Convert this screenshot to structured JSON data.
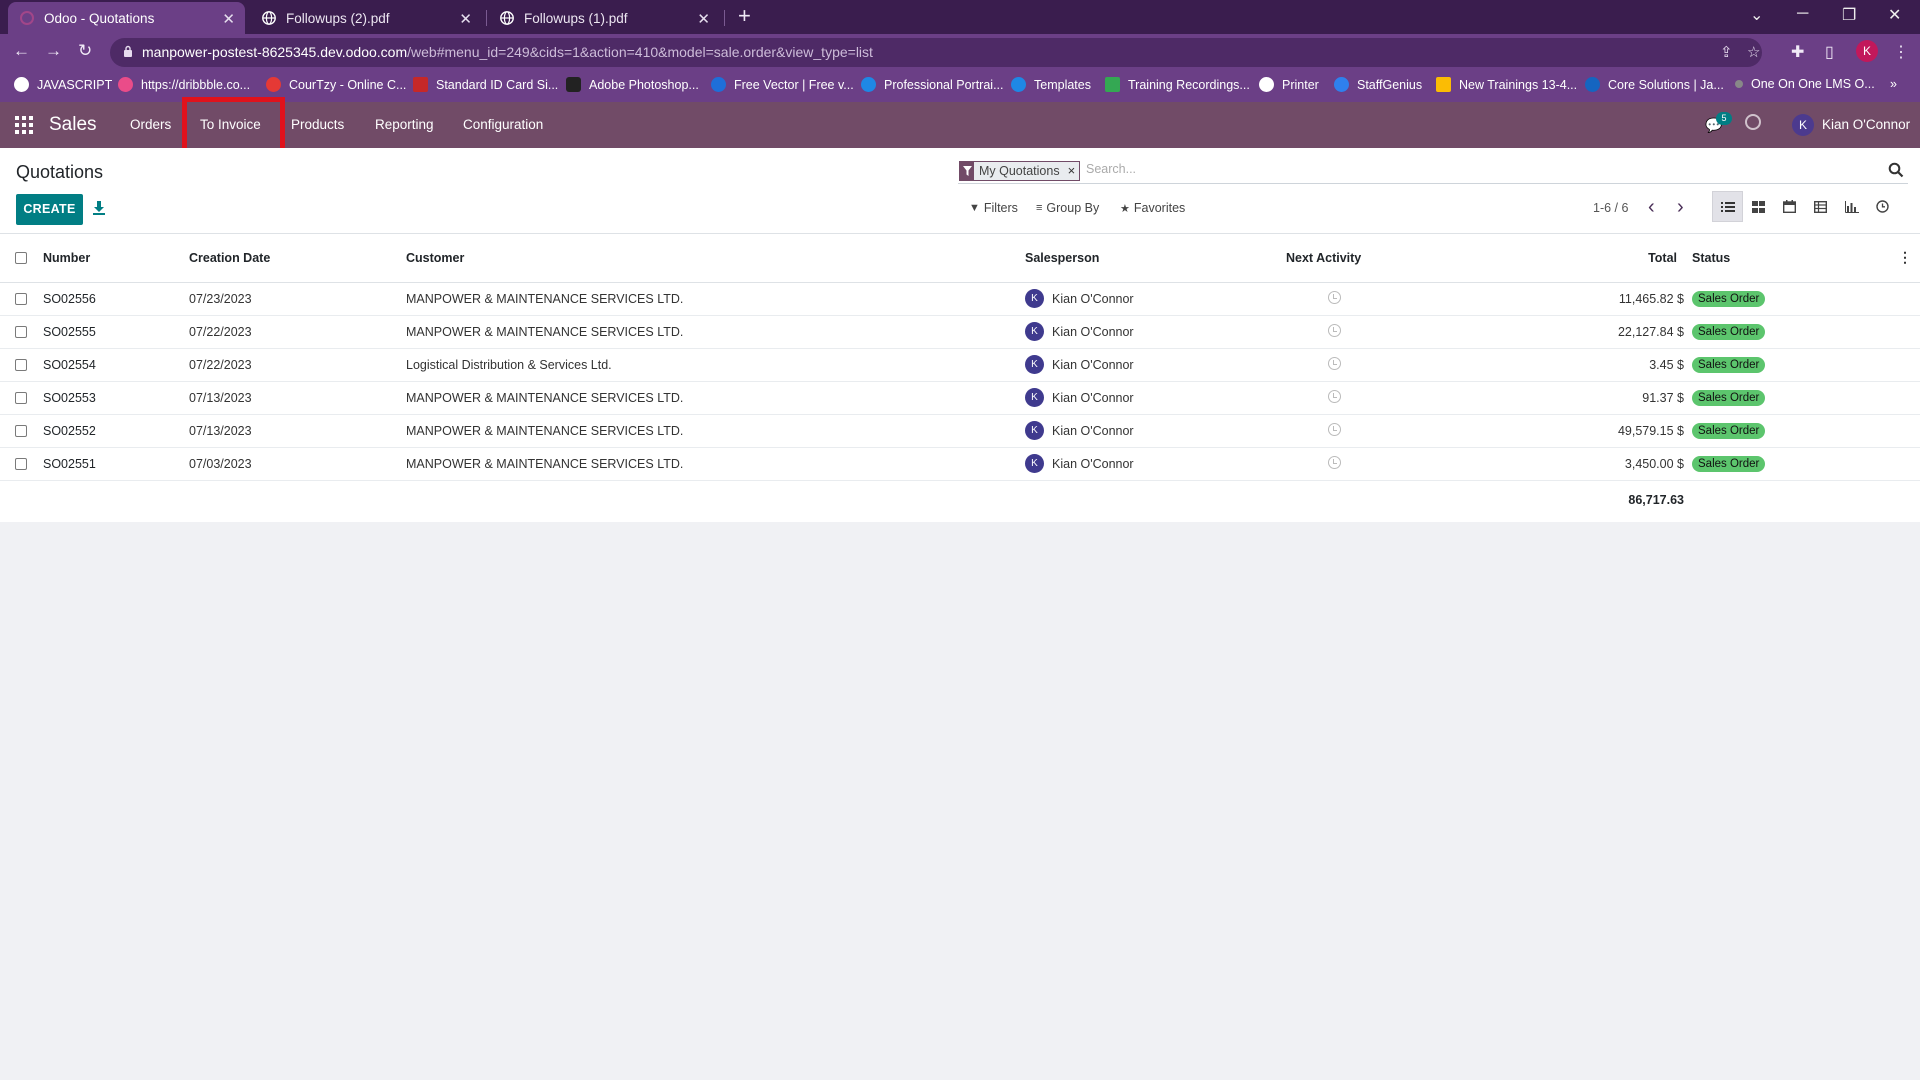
{
  "browser": {
    "tabs": [
      {
        "title": "Odoo - Quotations",
        "favicon": "odoo-icon",
        "active": true
      },
      {
        "title": "Followups (2).pdf",
        "favicon": "globe-icon",
        "active": false
      },
      {
        "title": "Followups (1).pdf",
        "favicon": "globe-icon",
        "active": false
      }
    ],
    "url_host": "manpower-postest-8625345.dev.odoo.com",
    "url_rest": "/web#menu_id=249&cids=1&action=410&model=sale.order&view_type=list",
    "profile_initial": "K",
    "bookmarks": [
      {
        "label": "JAVASCRIPT",
        "color": "#ffffff"
      },
      {
        "label": "https://dribbble.co...",
        "color": "#ea4c89"
      },
      {
        "label": "CourTzy - Online C...",
        "color": "#e53935"
      },
      {
        "label": "Standard ID Card Si...",
        "color": "#c62828"
      },
      {
        "label": "Adobe Photoshop...",
        "color": "#222222"
      },
      {
        "label": "Free Vector | Free v...",
        "color": "#1e6fd9"
      },
      {
        "label": "Professional Portrai...",
        "color": "#1e88e5"
      },
      {
        "label": "Templates",
        "color": "#1e88e5"
      },
      {
        "label": "Training Recordings...",
        "color": "#34a853"
      },
      {
        "label": "Printer",
        "color": "#ffffff"
      },
      {
        "label": "StaffGenius",
        "color": "#2f80ed"
      },
      {
        "label": "New Trainings 13-4...",
        "color": "#fbbc04"
      },
      {
        "label": "Core Solutions | Ja...",
        "color": "#1565c0"
      },
      {
        "label": "One On One LMS O...",
        "color": "#888888"
      }
    ],
    "more_bookmarks": "»"
  },
  "app": {
    "name": "Sales",
    "menu": [
      "Orders",
      "To Invoice",
      "Products",
      "Reporting",
      "Configuration"
    ],
    "highlighted_menu": "To Invoice",
    "message_count": "5",
    "user_initial": "K",
    "user_name": "Kian O'Connor"
  },
  "control_panel": {
    "title": "Quotations",
    "create_label": "CREATE",
    "facet_label": "My Quotations",
    "facet_remove": "×",
    "search_placeholder": "Search...",
    "filters_label": "Filters",
    "groupby_label": "Group By",
    "favorites_label": "Favorites",
    "pager": "1-6 / 6"
  },
  "list": {
    "columns": [
      "Number",
      "Creation Date",
      "Customer",
      "Salesperson",
      "Next Activity",
      "Total",
      "Status"
    ],
    "rows": [
      {
        "number": "SO02556",
        "date": "07/23/2023",
        "customer": "MANPOWER & MAINTENANCE SERVICES LTD.",
        "salesperson": "Kian O'Connor",
        "initial": "K",
        "total": "11,465.82 $",
        "status": "Sales Order"
      },
      {
        "number": "SO02555",
        "date": "07/22/2023",
        "customer": "MANPOWER & MAINTENANCE SERVICES LTD.",
        "salesperson": "Kian O'Connor",
        "initial": "K",
        "total": "22,127.84 $",
        "status": "Sales Order"
      },
      {
        "number": "SO02554",
        "date": "07/22/2023",
        "customer": "Logistical Distribution & Services Ltd.",
        "salesperson": "Kian O'Connor",
        "initial": "K",
        "total": "3.45 $",
        "status": "Sales Order"
      },
      {
        "number": "SO02553",
        "date": "07/13/2023",
        "customer": "MANPOWER & MAINTENANCE SERVICES LTD.",
        "salesperson": "Kian O'Connor",
        "initial": "K",
        "total": "91.37 $",
        "status": "Sales Order"
      },
      {
        "number": "SO02552",
        "date": "07/13/2023",
        "customer": "MANPOWER & MAINTENANCE SERVICES LTD.",
        "salesperson": "Kian O'Connor",
        "initial": "K",
        "total": "49,579.15 $",
        "status": "Sales Order"
      },
      {
        "number": "SO02551",
        "date": "07/03/2023",
        "customer": "MANPOWER & MAINTENANCE SERVICES LTD.",
        "salesperson": "Kian O'Connor",
        "initial": "K",
        "total": "3,450.00 $",
        "status": "Sales Order"
      }
    ],
    "grand_total": "86,717.63"
  },
  "colors": {
    "odoo_primary": "#714b67",
    "create_button": "#017e84",
    "status_badge": "#5cc56d",
    "highlight_box": "#e0121c"
  }
}
